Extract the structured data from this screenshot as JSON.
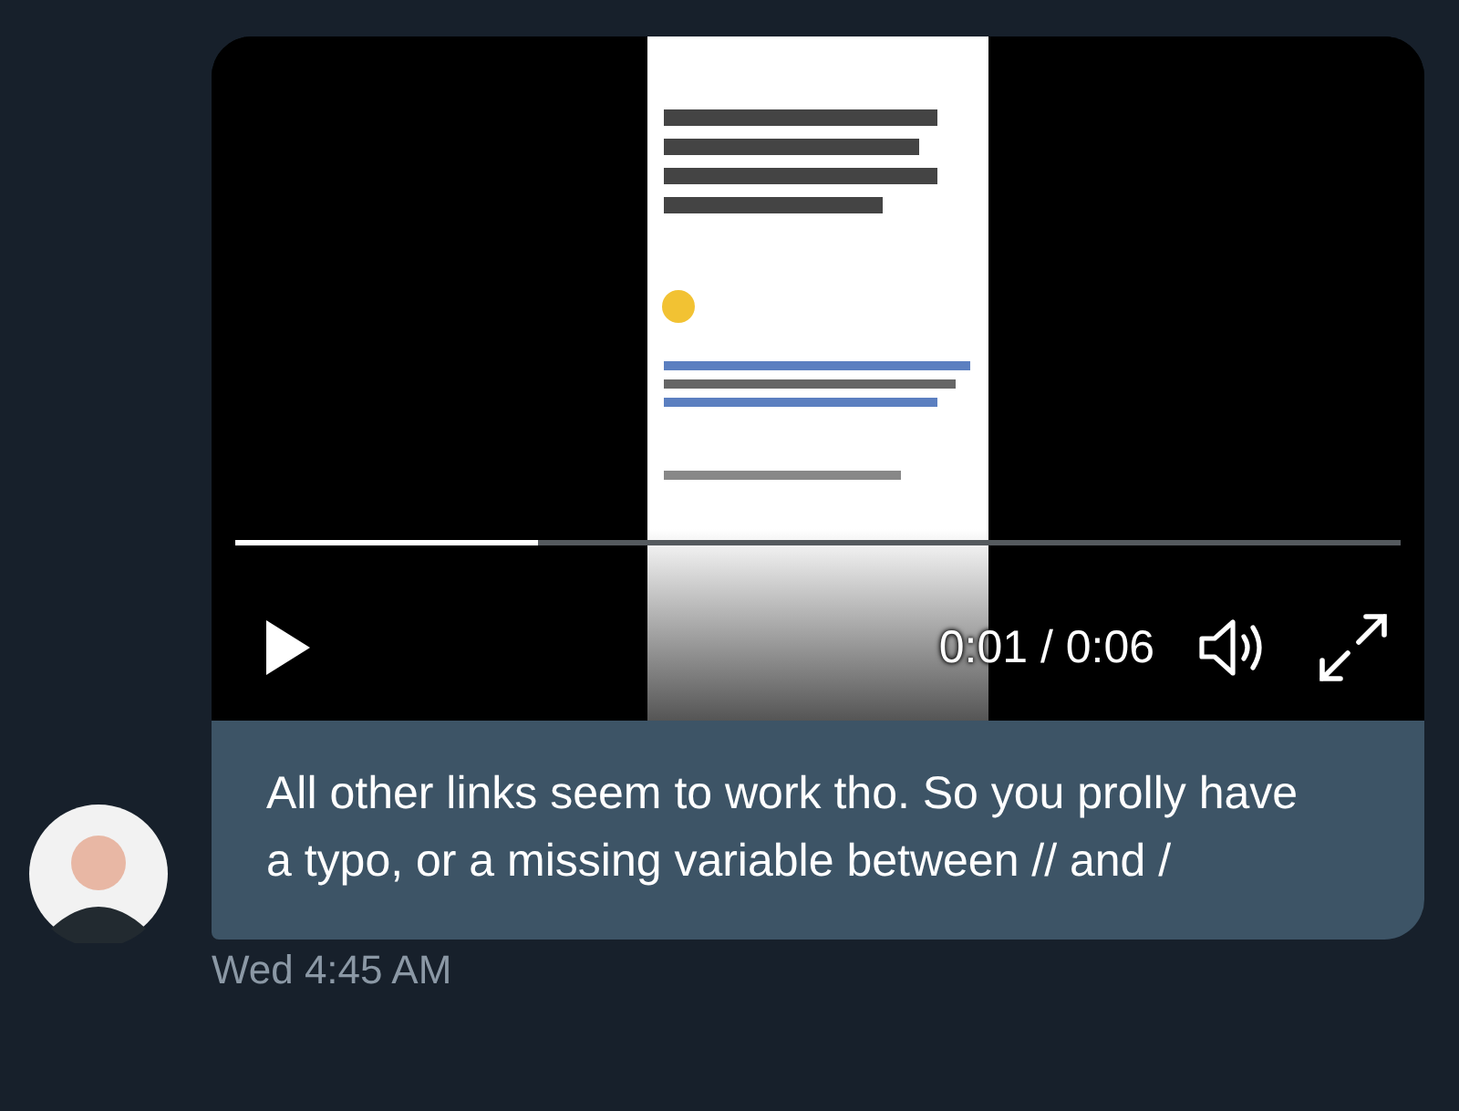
{
  "video": {
    "playing": false,
    "progress": {
      "level": 0.26
    },
    "time": "0:01 / 0:06"
  },
  "message": {
    "text": "All other links seem to work tho. So you prolly have a typo, or a missing variable between // and /",
    "timestamp": "Wed 4:45 AM"
  }
}
